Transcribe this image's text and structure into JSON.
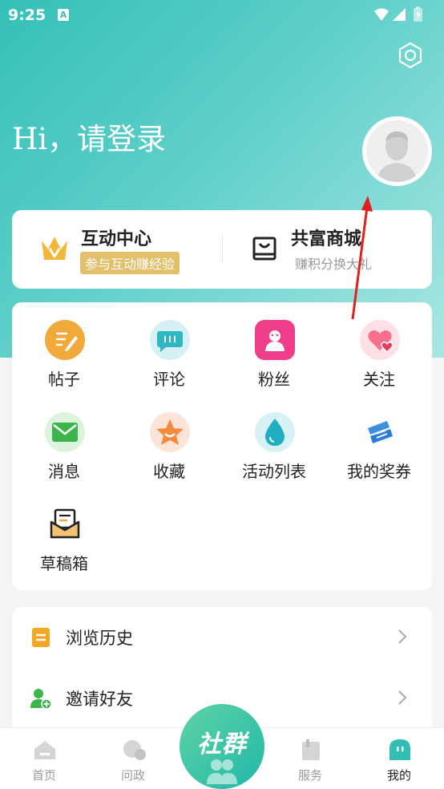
{
  "status_bar": {
    "time": "9:25",
    "notification_icon_letter": "A"
  },
  "header": {
    "greeting": "Hi，请登录",
    "settings_icon": "hexagon-settings-icon",
    "avatar_icon": "default-avatar-icon"
  },
  "top_card": {
    "left": {
      "title": "互动中心",
      "subtitle": "参与互动赚经验",
      "icon": "crown-icon",
      "badge_color": "#e2bf6b"
    },
    "right": {
      "title": "共富商城",
      "subtitle": "赚积分换大礼",
      "icon": "store-bag-icon"
    }
  },
  "grid": {
    "items": [
      {
        "label": "帖子",
        "icon": "post-icon"
      },
      {
        "label": "评论",
        "icon": "comment-icon"
      },
      {
        "label": "粉丝",
        "icon": "fans-icon"
      },
      {
        "label": "关注",
        "icon": "follow-heart-icon"
      },
      {
        "label": "消息",
        "icon": "message-icon"
      },
      {
        "label": "收藏",
        "icon": "favorite-star-icon"
      },
      {
        "label": "活动列表",
        "icon": "activity-drop-icon"
      },
      {
        "label": "我的奖券",
        "icon": "ticket-icon"
      },
      {
        "label": "草稿箱",
        "icon": "draft-box-icon"
      }
    ]
  },
  "list": {
    "items": [
      {
        "label": "浏览历史",
        "icon": "history-icon"
      },
      {
        "label": "邀请好友",
        "icon": "invite-friend-icon"
      }
    ]
  },
  "tabbar": {
    "tabs": [
      {
        "label": "首页",
        "icon": "home-icon"
      },
      {
        "label": "问政",
        "icon": "inquiry-icon"
      },
      {
        "label": "服务",
        "icon": "service-icon"
      },
      {
        "label": "我的",
        "icon": "profile-icon"
      }
    ],
    "center": {
      "label": "社群",
      "icon": "community-icon"
    },
    "accent_color": "#21b8a8"
  }
}
